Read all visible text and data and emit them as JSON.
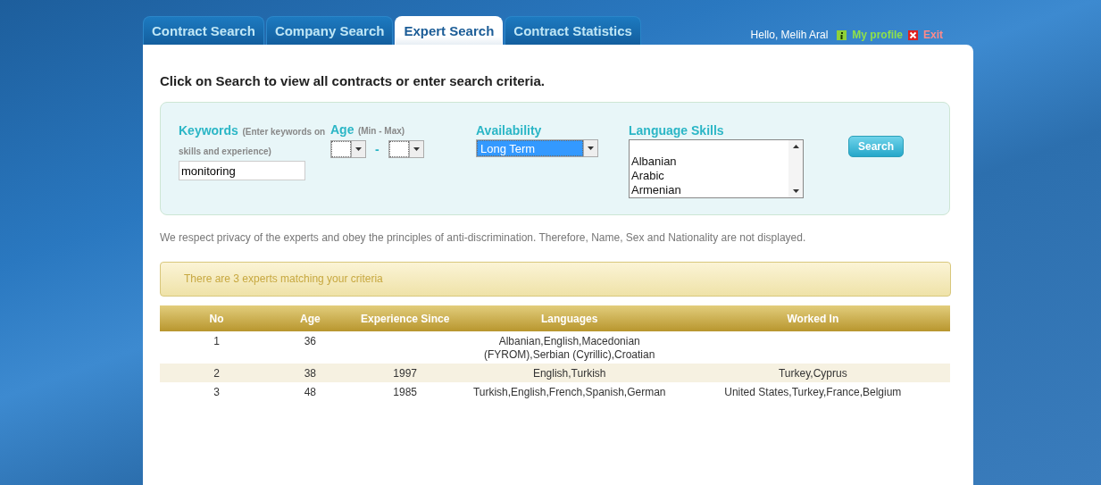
{
  "tabs": [
    {
      "label": "Contract Search",
      "selected": false
    },
    {
      "label": "Company Search",
      "selected": false
    },
    {
      "label": "Expert Search",
      "selected": true
    },
    {
      "label": "Contract Statistics",
      "selected": false
    }
  ],
  "user": {
    "greeting": "Hello, Melih Aral",
    "profile": "My profile",
    "exit": "Exit"
  },
  "intro": "Click on Search to view all contracts or enter search criteria.",
  "form": {
    "keywords": {
      "label": "Keywords",
      "hint": "(Enter keywords on skills and experience)",
      "value": "monitoring"
    },
    "age": {
      "label": "Age",
      "hint": "(Min - Max)",
      "separator": "-"
    },
    "availability": {
      "label": "Availability",
      "value": "Long Term"
    },
    "languages": {
      "label": "Language Skills",
      "options": [
        "Albanian",
        "Arabic",
        "Armenian"
      ]
    },
    "button": "Search"
  },
  "privacy": "We respect privacy of the experts and obey the principles of anti-discrimination. Therefore, Name, Sex and Nationality are not displayed.",
  "result": "There are 3 experts matching your criteria",
  "table": {
    "columns": [
      "No",
      "Age",
      "Experience Since",
      "Languages",
      "Worked In"
    ],
    "rows": [
      {
        "cells": [
          "1",
          "36",
          "",
          "Albanian,English,Macedonian (FYROM),Serbian (Cyrillic),Croatian",
          ""
        ]
      },
      {
        "cells": [
          "2",
          "38",
          "1997",
          "English,Turkish",
          "Turkey,Cyprus"
        ]
      },
      {
        "cells": [
          "3",
          "48",
          "1985",
          "Turkish,English,French,Spanish,German",
          "United States,Turkey,France,Belgium"
        ]
      }
    ]
  }
}
